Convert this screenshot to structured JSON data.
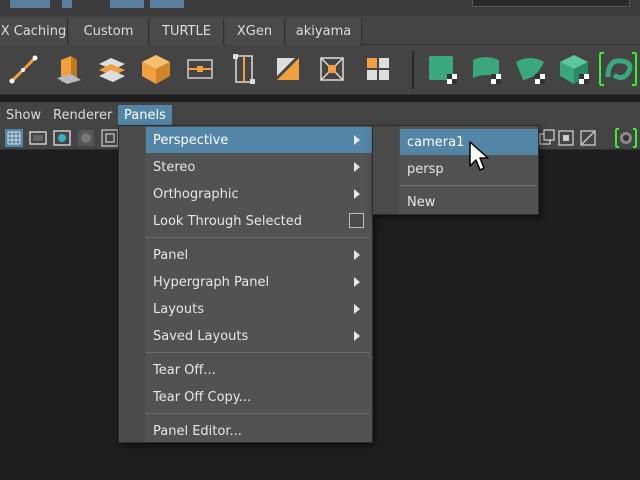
{
  "shelf_tabs": [
    "X Caching",
    "Custom",
    "TURTLE",
    "XGen",
    "akiyama"
  ],
  "shelf_icons": [
    "ep-curve-tool-icon",
    "extrude-icon",
    "duplicate-surface-icon",
    "cube-icon",
    "lattice-icon",
    "cluster-icon",
    "bend-icon",
    "sculpt-deformer-icon",
    "grid-icon",
    "green-cube-icon",
    "green-plane-icon",
    "green-flag-icon",
    "green-box-icon",
    "green-loop-icon"
  ],
  "menubar": {
    "show": "Show",
    "renderer": "Renderer",
    "panels": "Panels"
  },
  "panels_menu": {
    "items": [
      {
        "label": "Perspective",
        "submenu": true,
        "highlighted": true
      },
      {
        "label": "Stereo",
        "submenu": true
      },
      {
        "label": "Orthographic",
        "submenu": true
      },
      {
        "label": "Look Through Selected",
        "checkbox": false
      },
      {
        "label": "Panel",
        "submenu": true
      },
      {
        "label": "Hypergraph Panel",
        "submenu": true
      },
      {
        "label": "Layouts",
        "submenu": true
      },
      {
        "label": "Saved Layouts",
        "submenu": true
      },
      {
        "label": "Tear Off..."
      },
      {
        "label": "Tear Off Copy..."
      },
      {
        "label": "Panel Editor..."
      }
    ]
  },
  "perspective_submenu": {
    "items": [
      {
        "label": "camera1",
        "highlighted": true
      },
      {
        "label": "persp"
      },
      {
        "label": "New"
      }
    ]
  },
  "colors": {
    "highlight": "#5285a6",
    "menu_bg": "#525252",
    "shelf_orange": "#f0a040",
    "shelf_green": "#3aa87a"
  }
}
